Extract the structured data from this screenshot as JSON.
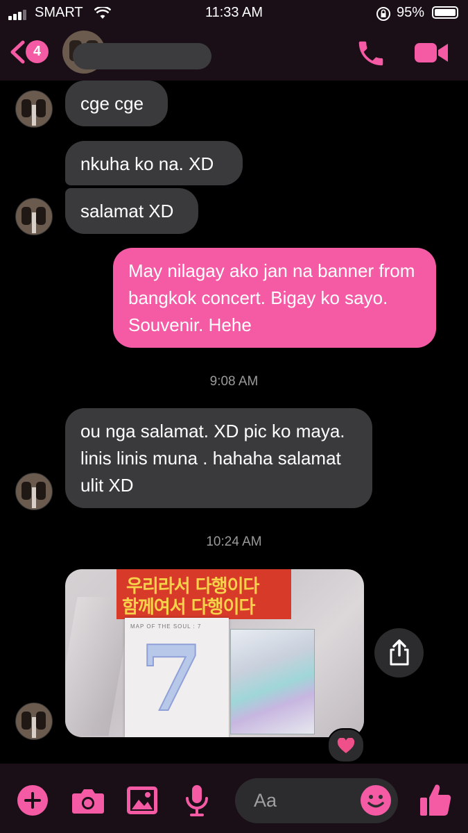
{
  "status": {
    "carrier": "SMART",
    "time": "11:33 AM",
    "battery": "95%"
  },
  "header": {
    "back_count": "4"
  },
  "messages": {
    "m1": "cge cge",
    "m2": "nkuha ko na. XD",
    "m3": "salamat XD",
    "m4": "May nilagay ako jan na banner from bangkok concert. Bigay ko sayo. Souvenir. Hehe",
    "ts1": "9:08 AM",
    "m5": "ou nga  salamat. XD pic ko maya. linis linis muna . hahaha salamat ulit XD",
    "ts2": "10:24 AM"
  },
  "photo": {
    "banner_line1": "우리라서 다행이다",
    "banner_line2": "함께여서 다행이다",
    "album_title": "MAP OF THE SOUL : 7",
    "album_number": "7"
  },
  "composer": {
    "placeholder": "Aa"
  },
  "colors": {
    "accent": "#f55aa5",
    "bubble_incoming": "#3a3a3c",
    "background": "#000000"
  }
}
